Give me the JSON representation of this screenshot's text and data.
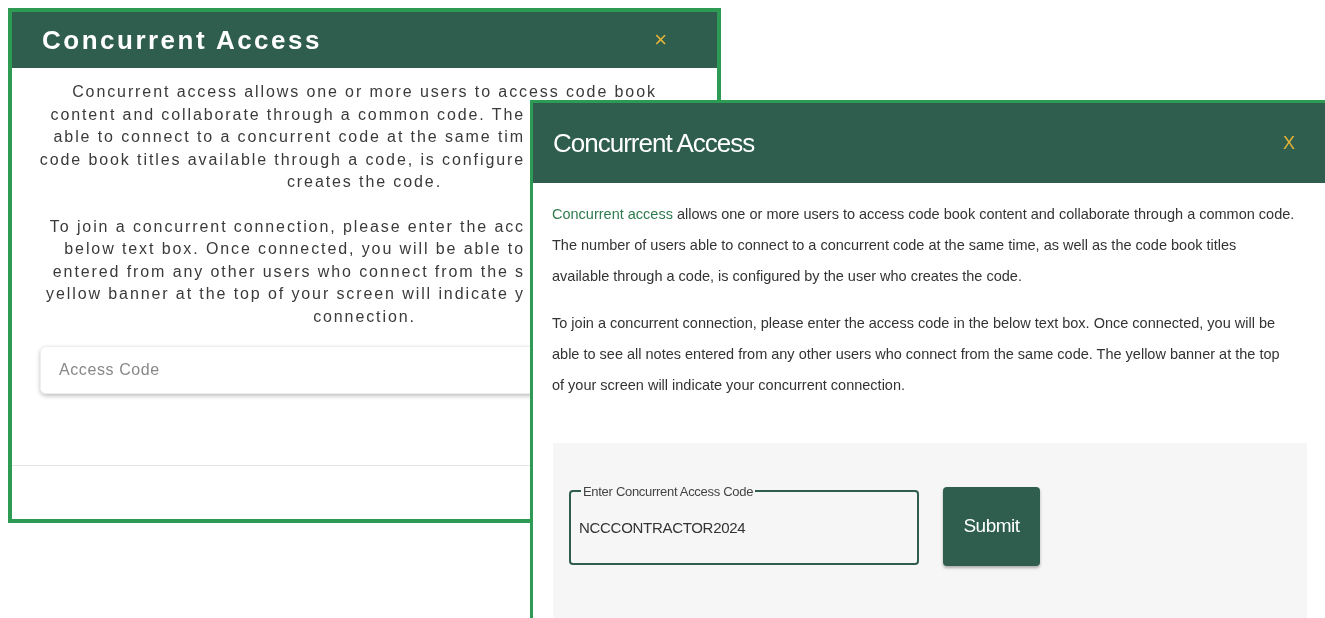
{
  "back_dialog": {
    "title": "Concurrent Access",
    "close": "×",
    "paragraphs": [
      [
        "Concurrent access allows one or more users to access code book",
        "content and collaborate through a common code. The",
        "able to connect to a concurrent code at the same tim",
        "code book titles available through a code, is configure",
        "creates the code."
      ],
      [
        "To join a concurrent connection, please enter the acc",
        "below text box. Once connected, you will be able to",
        "entered from any other users who connect from the s",
        "yellow banner at the top of your screen will indicate y",
        "connection."
      ]
    ],
    "field": {
      "placeholder": "Access Code"
    }
  },
  "front_dialog": {
    "title": "Concurrent Access",
    "close": "X",
    "paragraphs": [
      {
        "link": "Concurrent access",
        "text": " allows one or more users to access code book content and collaborate through a common code. The number of users able to connect to a concurrent code at the same time, as well as the code book titles available through a code, is configured by the user who creates the code."
      },
      {
        "text": "To join a concurrent connection, please enter the access code in the below text box. Once connected, you will be able to see all notes entered from any other users who connect from the same code. The yellow banner at the top of your screen will indicate your concurrent connection."
      }
    ],
    "field": {
      "label": "Enter Concurrent Access Code",
      "value": "NCCCONTRACTOR2024"
    },
    "submit": "Submit"
  }
}
